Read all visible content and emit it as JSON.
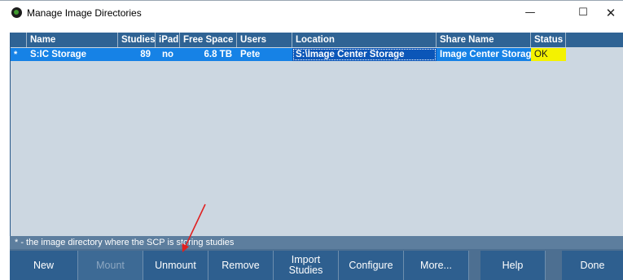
{
  "window": {
    "title": "Manage Image Directories",
    "minimize_glyph": "—",
    "maximize_glyph": "☐",
    "close_glyph": "✕"
  },
  "table": {
    "columns": [
      "Name",
      "Studies",
      "iPad",
      "Free Space",
      "Users",
      "Location",
      "Share Name",
      "Status"
    ],
    "rows": [
      {
        "marker": "*",
        "name": "S:IC Storage",
        "studies": "89",
        "ipad": "no",
        "free_space": "6.8 TB",
        "users": "Pete",
        "location": "S:\\Image Center Storage",
        "share_name": "Image Center Storage",
        "status": "OK"
      }
    ],
    "selected_row": 0,
    "colors": {
      "header_bg": "#2f6394",
      "selected_row_bg": "#1682e6",
      "status_ok_bg": "#f4f200",
      "grid_bg": "#ccd7e1"
    }
  },
  "footer_note": "* - the image directory where the SCP is storing studies",
  "buttons": {
    "new": "New",
    "mount": "Mount",
    "unmount": "Unmount",
    "remove": "Remove",
    "import_line1": "Import",
    "import_line2": "Studies",
    "configure": "Configure",
    "more": "More...",
    "help": "Help",
    "done": "Done"
  },
  "annotation": {
    "color": "#e02020",
    "target": "unmount-button"
  }
}
